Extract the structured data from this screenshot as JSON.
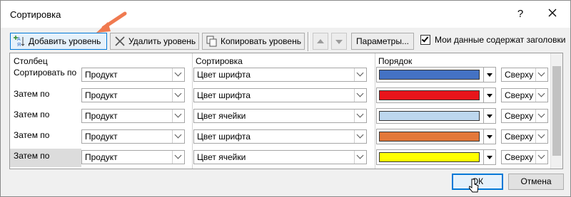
{
  "window": {
    "title": "Сортировка",
    "help_label": "?"
  },
  "toolbar": {
    "add_level_label": "Добавить уровень",
    "delete_level_label": "Удалить уровень",
    "copy_level_label": "Копировать уровень",
    "options_label": "Параметры...",
    "headers_checkbox_label": "Мои данные содержат заголовки",
    "headers_checked": true
  },
  "columns": {
    "column": "Столбец",
    "sort_on": "Сортировка",
    "order": "Порядок"
  },
  "rows": [
    {
      "label": "Сортировать по",
      "column": "Продукт",
      "sort_on": "Цвет шрифта",
      "color": "#4472c4",
      "position": "Сверху"
    },
    {
      "label": "Затем по",
      "column": "Продукт",
      "sort_on": "Цвет шрифта",
      "color": "#e8141b",
      "position": "Сверху"
    },
    {
      "label": "Затем по",
      "column": "Продукт",
      "sort_on": "Цвет ячейки",
      "color": "#bdd7ee",
      "position": "Сверху"
    },
    {
      "label": "Затем по",
      "column": "Продукт",
      "sort_on": "Цвет шрифта",
      "color": "#e3783a",
      "position": "Сверху"
    },
    {
      "label": "Затем по",
      "column": "Продукт",
      "sort_on": "Цвет ячейки",
      "color": "#ffff00",
      "position": "Сверху"
    }
  ],
  "footer": {
    "ok_label": "ОК",
    "cancel_label": "Отмена"
  },
  "colors": {
    "accent": "#0078d7",
    "annotation_arrow": "#f07a50"
  }
}
